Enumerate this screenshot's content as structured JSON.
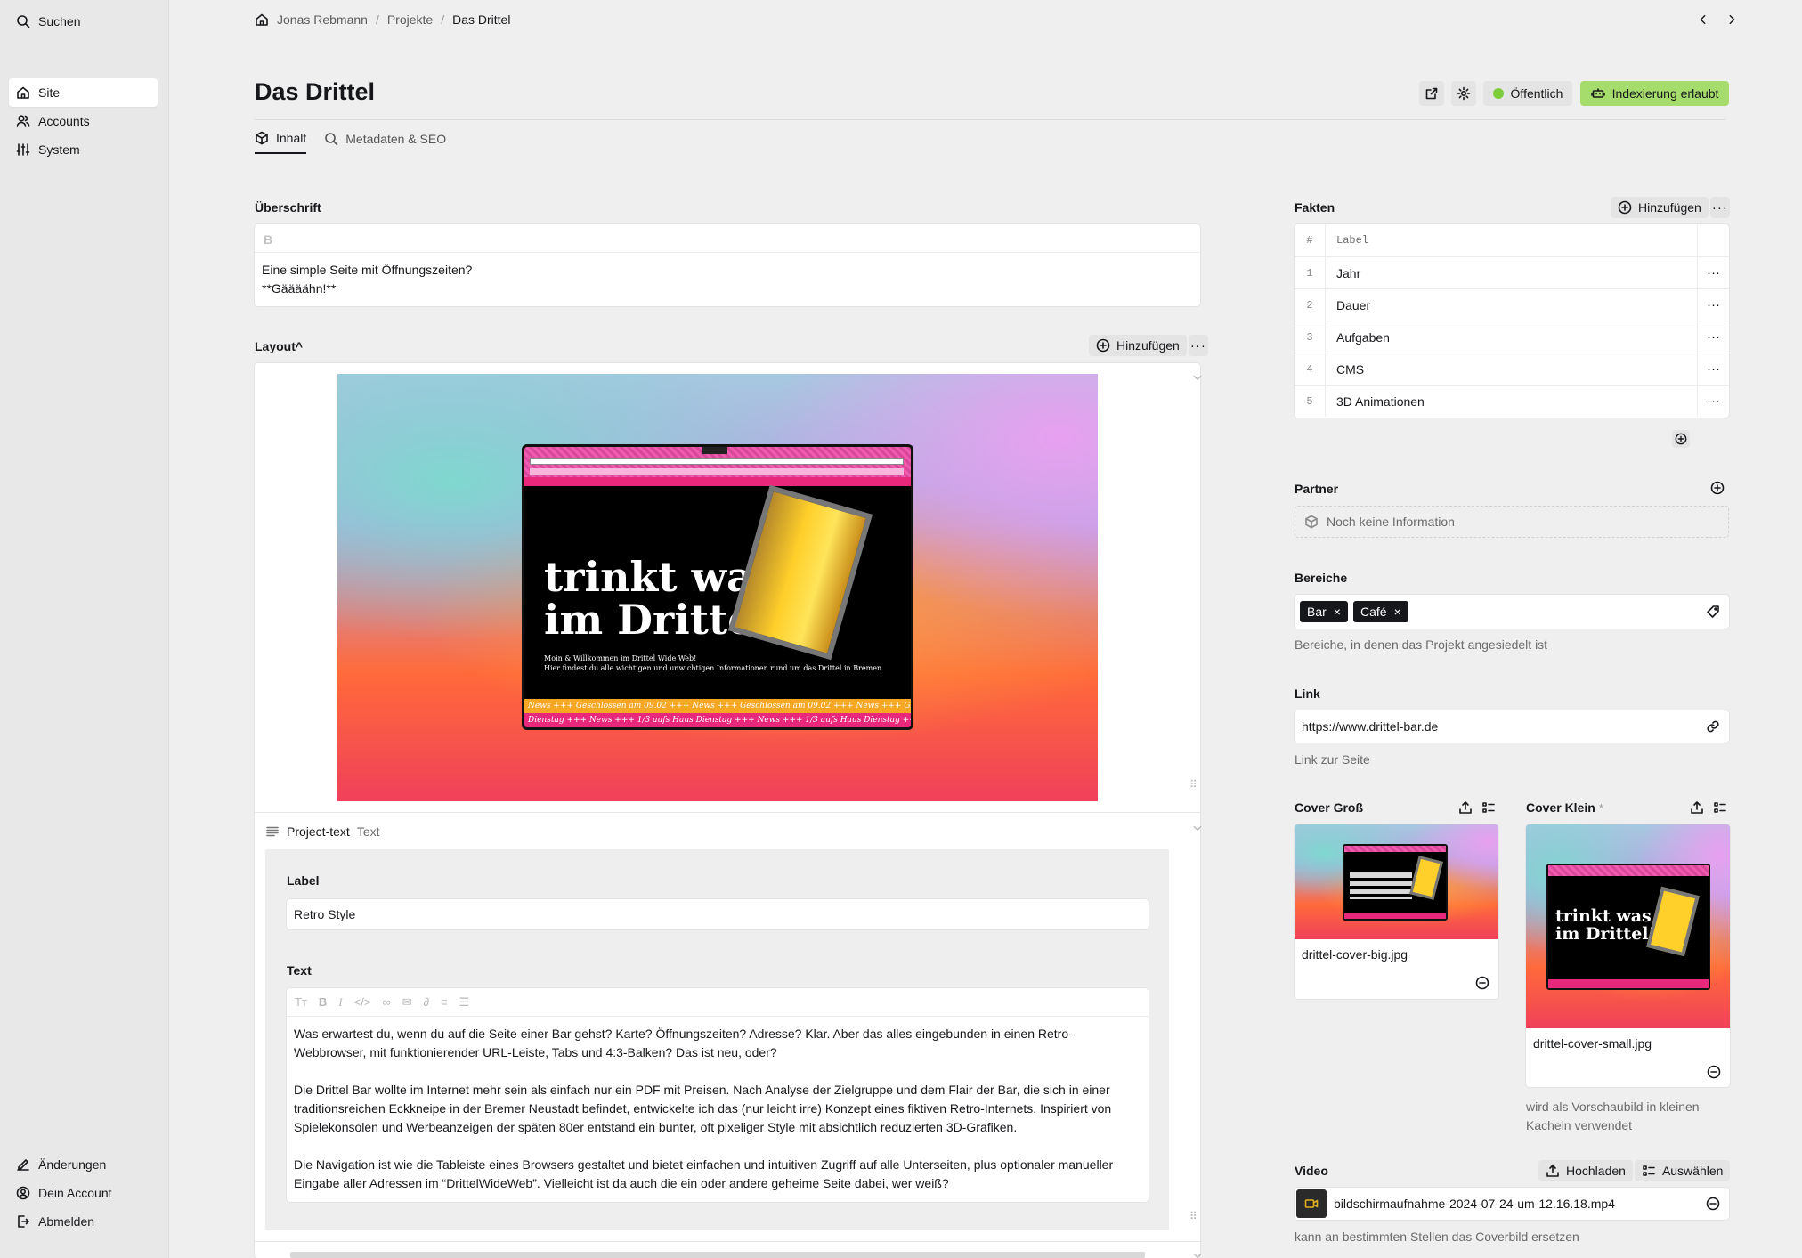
{
  "sidebar": {
    "search": "Suchen",
    "nav": [
      "Site",
      "Accounts",
      "System"
    ],
    "bottom": [
      "Änderungen",
      "Dein Account",
      "Abmelden"
    ]
  },
  "breadcrumb": [
    "Jonas Rebmann",
    "Projekte",
    "Das Drittel"
  ],
  "page": {
    "title": "Das Drittel",
    "status": "Öffentlich",
    "indexing": "Indexierung erlaubt",
    "tabs": [
      "Inhalt",
      "Metadaten & SEO"
    ]
  },
  "ueberschrift": {
    "label": "Überschrift",
    "toolbar_bold": "B",
    "line1": "Eine simple Seite mit Öffnungszeiten?",
    "line2": "**Gäääähn!**"
  },
  "layout": {
    "label": "Layout^",
    "add": "Hinzufügen",
    "mock": {
      "title_line1": "trinkt was",
      "title_line2": "im Drittel!",
      "welcome1": "Moin & Willkommen im Drittel Wide Web!",
      "welcome2": "Hier findest du alle wichtigen und unwichtigen Informationen rund um das Drittel in Bremen.",
      "ticker1": "News +++ Geschlossen am 09.02 +++ News +++ Geschlossen am 09.02 +++ News +++ Geschlossen am 09.02",
      "ticker2": "Dienstag +++ News +++ 1/3 aufs Haus Dienstag +++ News +++ 1/3 aufs Haus Dienstag +++ News +++ 1/3 au"
    },
    "block": {
      "name": "Project-text",
      "type": "Text",
      "label_label": "Label",
      "label_value": "Retro Style",
      "text_label": "Text",
      "paragraphs": [
        "Was erwartest du, wenn du auf die Seite einer Bar gehst? Karte? Öffnungszeiten? Adresse? Klar. Aber das alles eingebunden in einen Retro-Webbrowser, mit funktionierender URL-Leiste, Tabs und 4:3-Balken? Das ist neu, oder?",
        "Die Drittel Bar wollte im Internet mehr sein als einfach nur ein PDF mit Preisen. Nach Analyse der Zielgruppe und dem Flair der Bar, die sich in einer traditionsreichen Eckkneipe in der Bremer Neustadt befindet, entwickelte ich das (nur leicht irre) Konzept eines fiktiven Retro-Internets. Inspiriert von Spielekonsolen und Werbeanzeigen der späten 80er entstand ein bunter, oft pixeliger Style mit absichtlich reduzierten 3D-Grafiken.",
        "Die Navigation ist wie die Tableiste eines Browsers gestaltet und bietet einfachen und intuitiven Zugriff auf alle Unterseiten, plus optionaler manueller Eingabe aller Adressen im “DrittelWideWeb”. Vielleicht ist da auch die ein oder andere geheime Seite dabei, wer weiß?"
      ]
    }
  },
  "fakten": {
    "label": "Fakten",
    "add": "Hinzufügen",
    "col_num": "#",
    "col_label": "Label",
    "rows": [
      {
        "n": "1",
        "label": "Jahr"
      },
      {
        "n": "2",
        "label": "Dauer"
      },
      {
        "n": "3",
        "label": "Aufgaben"
      },
      {
        "n": "4",
        "label": "CMS"
      },
      {
        "n": "5",
        "label": "3D Animationen"
      }
    ]
  },
  "partner": {
    "label": "Partner",
    "empty": "Noch keine Information"
  },
  "bereiche": {
    "label": "Bereiche",
    "tags": [
      "Bar",
      "Café"
    ],
    "help": "Bereiche, in denen das Projekt angesiedelt ist"
  },
  "link": {
    "label": "Link",
    "value": "https://www.drittel-bar.de",
    "help": "Link zur Seite"
  },
  "cover_gross": {
    "label": "Cover Groß",
    "file": "drittel-cover-big.jpg"
  },
  "cover_klein": {
    "label": "Cover Klein",
    "required": "*",
    "file": "drittel-cover-small.jpg",
    "help1": "wird als Vorschaubild in kleinen",
    "help2": "Kacheln verwendet"
  },
  "video": {
    "label": "Video",
    "upload": "Hochladen",
    "select": "Auswählen",
    "file": "bildschirmaufnahme-2024-07-24-um-12.16.18.mp4",
    "help": "kann an bestimmten Stellen das Coverbild ersetzen"
  },
  "colors": {
    "public": "#7dcc3a",
    "indexing_bg": "#a6dc6c",
    "accent_pink": "#f05ab0"
  }
}
